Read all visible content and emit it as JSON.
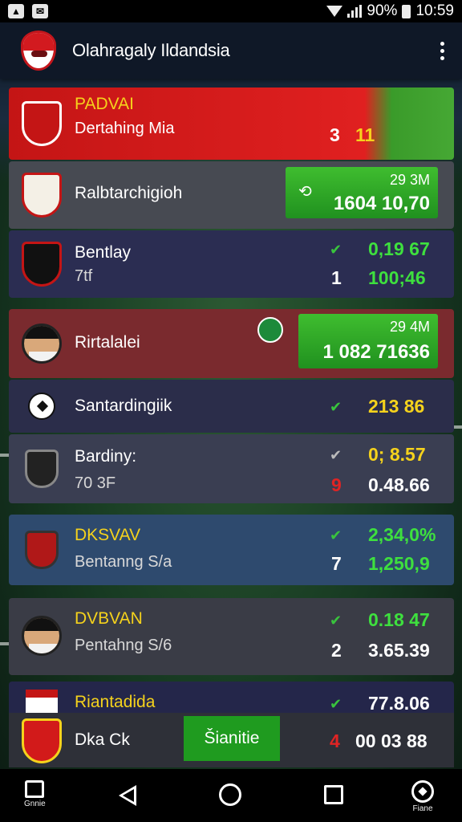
{
  "status_bar": {
    "battery": "90%",
    "time": "10:59"
  },
  "app": {
    "title": "Olahragaly Ildandsia"
  },
  "rows": [
    {
      "name": "PADVAI",
      "sub": "Dertahing Mia",
      "value_a": "3",
      "value_b": "11",
      "bg": "#d01a1a"
    },
    {
      "name": "Ralbtarchigioh",
      "box_top": "29 3M",
      "box_main": "1604 10,70",
      "bg": "#474a52"
    },
    {
      "name": "Bentlay",
      "sub": "7tf",
      "value_top": "0,19 67",
      "value_a": "1",
      "value_b": "100;46",
      "bg": "#2b2d52"
    },
    {
      "name": "Rirtalalei",
      "box_top": "29 4M",
      "box_main": "1 082 71636",
      "bg": "#7a2a2e"
    },
    {
      "name": "Santardingiik",
      "value_b": "213 86",
      "bg": "#2b2d4a"
    },
    {
      "name": "Bardiny:",
      "sub": "70 3F",
      "value_top": "0; 8.57",
      "value_a": "9",
      "value_b": "0.48.66",
      "bg": "#3a3e52"
    },
    {
      "name": "DKSVAV",
      "sub": "Bentanng S/a",
      "value_top": "2,34,0%",
      "value_a": "7",
      "value_b": "1,250,9",
      "bg": "#2e4a6e"
    },
    {
      "name": "DVBVAN",
      "sub": "Pentahng S/6",
      "value_top": "0.18 47",
      "value_a": "2",
      "value_b": "3.65.39",
      "bg": "#3a3c46"
    },
    {
      "name": "Riantadida",
      "value_top": "77.8.06",
      "bg": "#24264a"
    }
  ],
  "bottom": {
    "name": "Dka Ck",
    "button": "Šianitie",
    "value_a": "4",
    "value_b": "00 03 88"
  },
  "nav": {
    "home_label": "Gnnie",
    "right_label": "Fiane"
  },
  "colors": {
    "accent_green": "#2fae2a",
    "value_green": "#3ee03e",
    "value_yellow": "#f5d21c",
    "value_red": "#e02424"
  }
}
